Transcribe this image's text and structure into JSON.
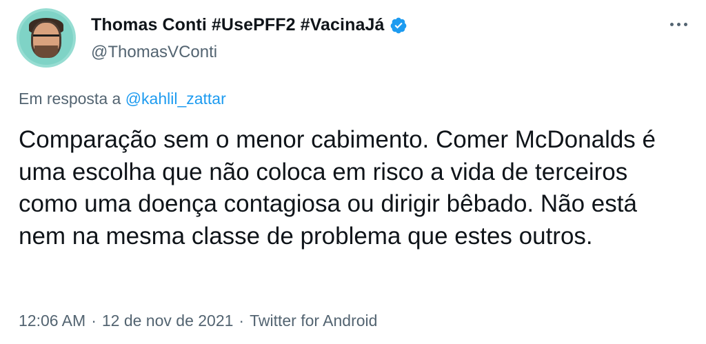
{
  "author": {
    "display_name": "Thomas Conti #UsePFF2 #VacinaJá",
    "handle": "@ThomasVConti",
    "verified_icon": "verified-badge-icon",
    "avatar_icon": "avatar"
  },
  "reply": {
    "prefix": "Em resposta a",
    "handle": "@kahlil_zattar"
  },
  "tweet": {
    "text": "Comparação sem o menor cabimento. Comer McDonalds é uma escolha que não coloca em risco a vida de terceiros como uma doença contagiosa ou dirigir bêbado. Não está nem na mesma classe de problema que estes outros."
  },
  "meta": {
    "time": "12:06 AM",
    "sep1": "·",
    "date": "12 de nov de 2021",
    "sep2": "·",
    "source": "Twitter for Android"
  },
  "colors": {
    "accent": "#1d9bf0",
    "secondary_text": "#536471",
    "primary_text": "#0f1419",
    "avatar_ring": "#7fd3c6"
  }
}
